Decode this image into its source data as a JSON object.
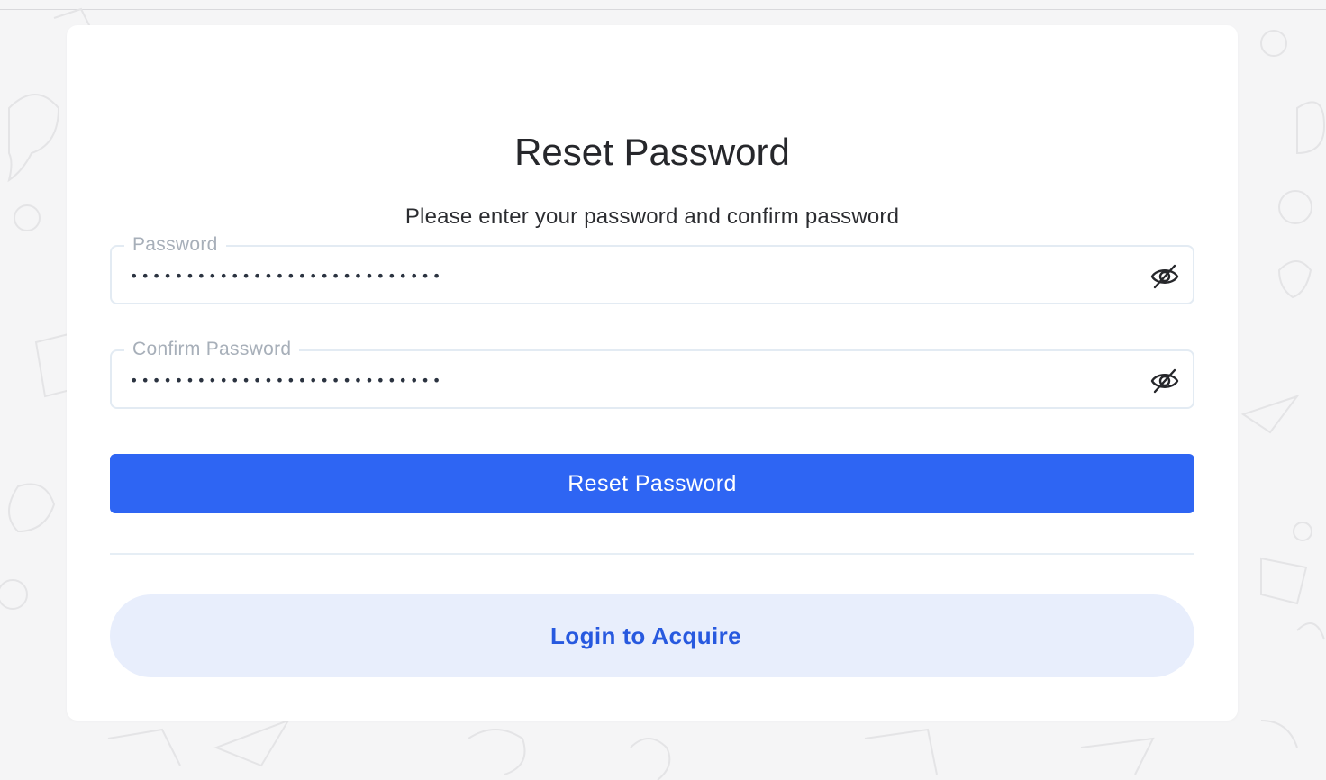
{
  "page": {
    "title": "Reset Password",
    "subtitle": "Please enter your password and confirm password"
  },
  "form": {
    "password": {
      "label": "Password",
      "value": "••••••••••••••••••••••••••••",
      "toggle_icon": "eye-slash-icon"
    },
    "confirm_password": {
      "label": "Confirm Password",
      "value": "••••••••••••••••••••••••••••",
      "toggle_icon": "eye-slash-icon"
    },
    "submit_label": "Reset Password"
  },
  "footer": {
    "login_link_label": "Login to Acquire"
  },
  "colors": {
    "primary": "#2e65f3",
    "secondary_bg": "#e8eefc",
    "secondary_text": "#2759df",
    "background": "#f5f5f6"
  }
}
